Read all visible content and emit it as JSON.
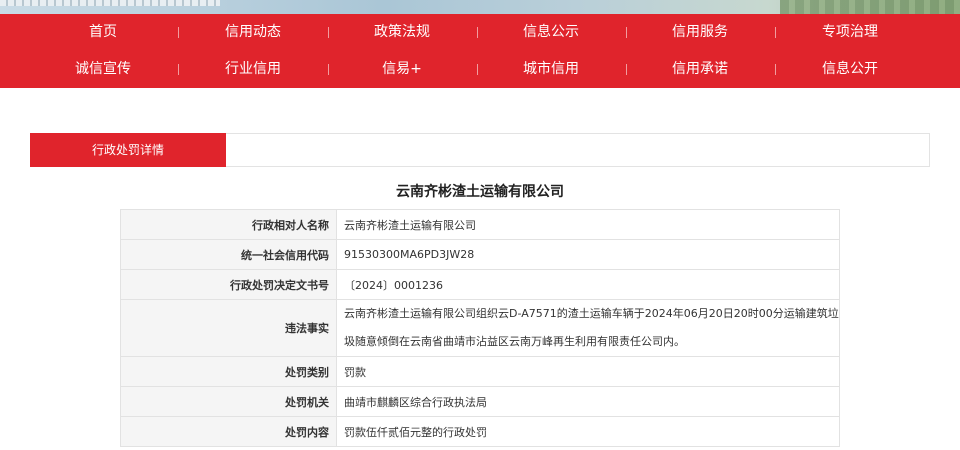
{
  "nav": {
    "row1": [
      "首页",
      "信用动态",
      "政策法规",
      "信息公示",
      "信用服务",
      "专项治理"
    ],
    "row2": [
      "诚信宣传",
      "行业信用",
      "信易+",
      "城市信用",
      "信用承诺",
      "信息公开"
    ]
  },
  "tabs": {
    "active": "行政处罚详情"
  },
  "title": "云南齐彬渣土运输有限公司",
  "rows": [
    {
      "label": "行政相对人名称",
      "value": "云南齐彬渣土运输有限公司"
    },
    {
      "label": "统一社会信用代码",
      "value": "91530300MA6PD3JW28"
    },
    {
      "label": "行政处罚决定文书号",
      "value": "〔2024〕0001236"
    },
    {
      "label": "违法事实",
      "value": "云南齐彬渣土运输有限公司组织云D-A7571的渣土运输车辆于2024年06月20日20时00分运输建筑垃圾随意倾倒在云南省曲靖市沾益区云南万峰再生利用有限责任公司内。"
    },
    {
      "label": "处罚类别",
      "value": "罚款"
    },
    {
      "label": "处罚机关",
      "value": "曲靖市麒麟区综合行政执法局"
    },
    {
      "label": "处罚内容",
      "value": "罚款伍仟贰佰元整的行政处罚"
    }
  ],
  "colors": {
    "brand_red": "#e0242c",
    "label_bg": "#f5f5f5",
    "border": "#e2e2e2"
  }
}
